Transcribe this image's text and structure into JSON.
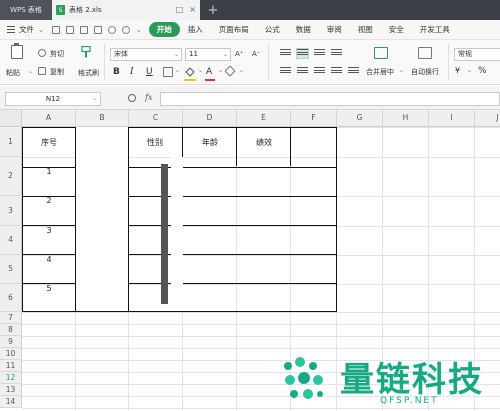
{
  "titlebar": {
    "app_tab": "WPS 表格",
    "doc_tab": "表格 2.xls",
    "doc_icon": "S",
    "tab_controls": [
      "□",
      "×"
    ],
    "new_tab": "+"
  },
  "menubar": {
    "file_label": "文件",
    "items": [
      "开始",
      "插入",
      "页面布局",
      "公式",
      "数据",
      "审阅",
      "视图",
      "安全",
      "开发工具"
    ],
    "active": "开始"
  },
  "ribbon": {
    "paste": "粘贴",
    "cut": "剪切",
    "copy": "复制",
    "format_painter": "格式刷",
    "font_name": "宋体",
    "font_size": "11",
    "grow_font": "A⁺",
    "shrink_font": "A⁻",
    "bold": "B",
    "italic": "I",
    "underline": "U",
    "font_color": "A",
    "merge_center": "合并居中",
    "wrap_text": "自动换行",
    "number_format": "常规",
    "percent": "%",
    "currency": "¥",
    "accent_color": "#2c9a5a",
    "font_color_bar": "#e0312f",
    "fill_color_bar": "#f1c40f"
  },
  "formula_bar": {
    "name_box": "N12",
    "fx": "fx",
    "value": ""
  },
  "sheet": {
    "columns": [
      "A",
      "B",
      "C",
      "D",
      "E",
      "F",
      "G",
      "H",
      "I",
      "J"
    ],
    "rows": [
      "1",
      "2",
      "3",
      "4",
      "5",
      "6",
      "7",
      "8",
      "9",
      "10",
      "11",
      "12",
      "13",
      "14"
    ],
    "highlighted_row": "12",
    "headers": [
      "序号",
      "性别",
      "年龄",
      "绩效"
    ],
    "serials": [
      "1",
      "2",
      "3",
      "4",
      "5"
    ]
  },
  "watermark": {
    "text": "量链科技",
    "sub": "QFSP.NET",
    "color": "#17a884"
  }
}
